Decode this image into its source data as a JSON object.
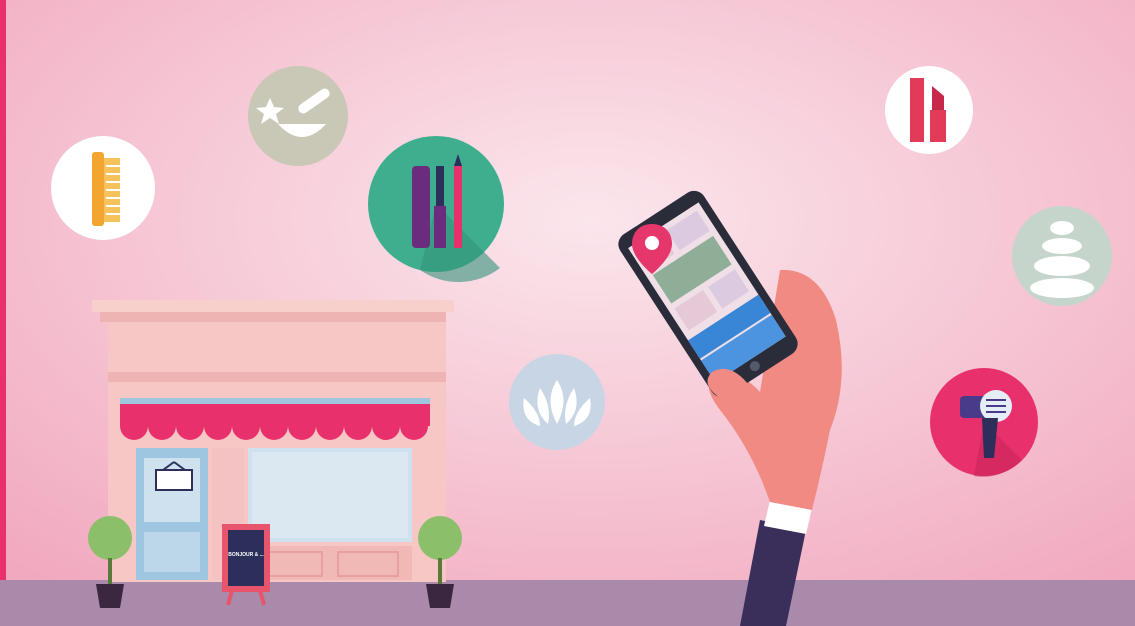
{
  "scene": {
    "colors": {
      "background": "#f3b6c9",
      "background_glow": "#fbe6ec",
      "accent": "#e8306c",
      "ground": "#a98aab",
      "awning": "#e8306c",
      "map_pin": "#e5376c"
    }
  },
  "shop": {
    "sign_text": "BONJOUR & ...",
    "colors": {
      "wall": "#f4c2c2",
      "window": "#cfe1ee",
      "door": "#9fc6e1",
      "board": "#2b2f5a"
    }
  },
  "phone": {
    "colors": {
      "body": "#2a2c3a",
      "map_green": "#8fae98",
      "map_blue": "#3a86d6",
      "map_base": "#f0dfe6"
    }
  },
  "icons": [
    {
      "name": "comb-icon",
      "bg": "#ffffff"
    },
    {
      "name": "mortar-pestle-icon",
      "bg": "#c9c7b6"
    },
    {
      "name": "mascara-eyeliner-icon",
      "bg": "#3fae8f"
    },
    {
      "name": "lotus-icon",
      "bg": "#c8d5e4"
    },
    {
      "name": "lipstick-icon",
      "bg": "#ffffff"
    },
    {
      "name": "spa-stones-icon",
      "bg": "#c6d5cb"
    },
    {
      "name": "hair-dryer-icon",
      "bg": "#e8306c"
    }
  ]
}
